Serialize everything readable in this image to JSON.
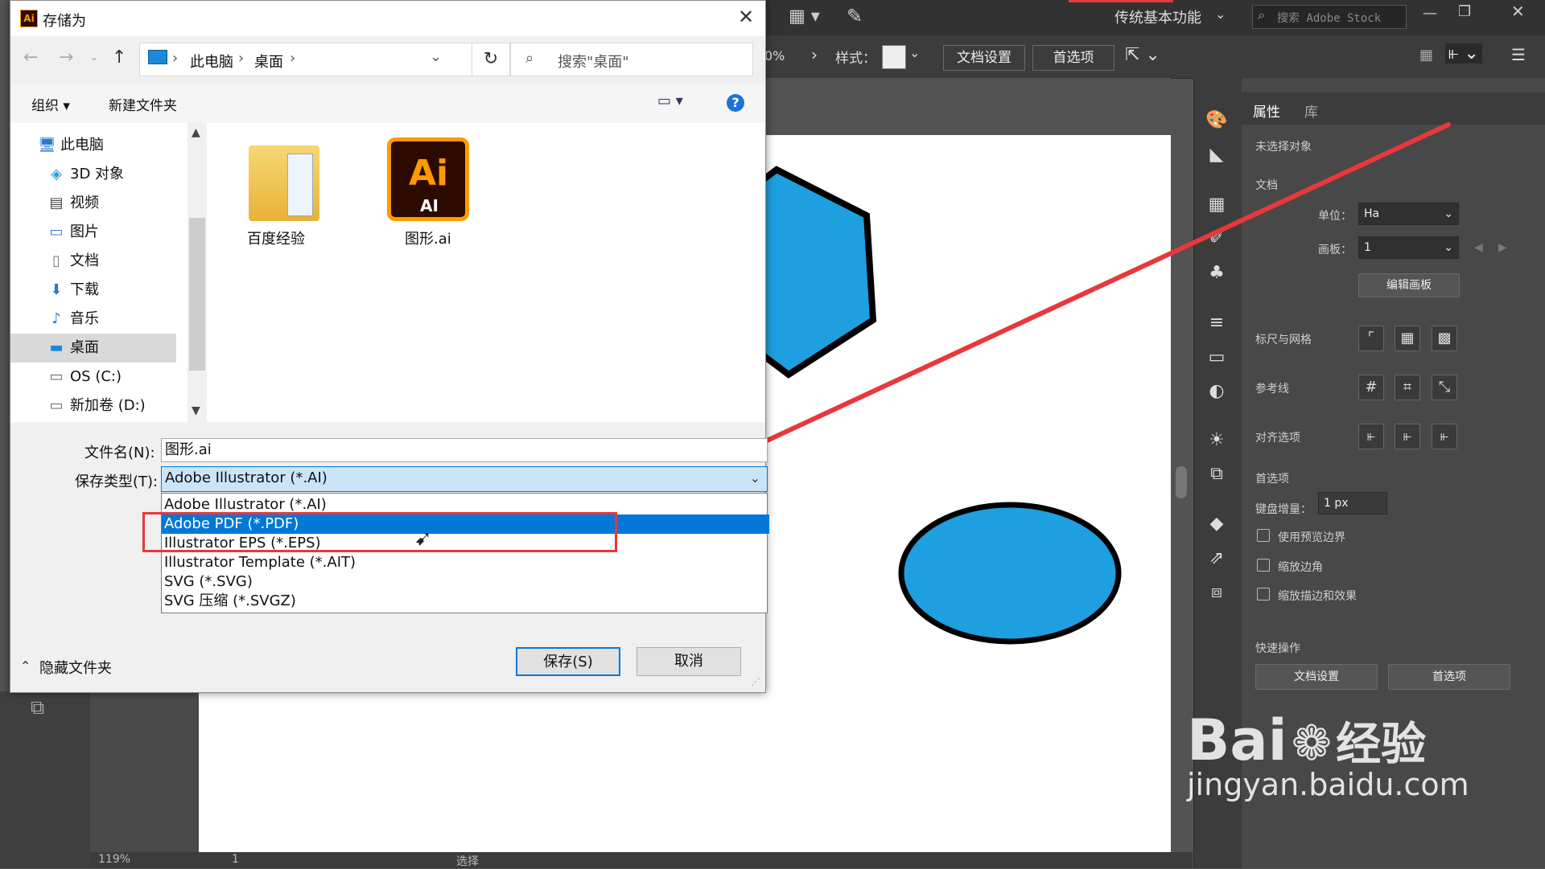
{
  "dialog": {
    "title": "存储为",
    "address": {
      "root": "此电脑",
      "folder": "桌面"
    },
    "search_placeholder": "搜索\"桌面\"",
    "toolbar": {
      "organize": "组织 ▾",
      "new_folder": "新建文件夹",
      "help": "?"
    },
    "nav_items": [
      "此电脑",
      "3D 对象",
      "视频",
      "图片",
      "文档",
      "下载",
      "音乐",
      "桌面",
      "OS (C:)",
      "新加卷 (D:)"
    ],
    "files": [
      {
        "name": "百度经验",
        "type": "folder"
      },
      {
        "name": "图形.ai",
        "type": "ai-file",
        "badge": "Ai",
        "badge_sub": "AI"
      }
    ],
    "filename_label": "文件名(N):",
    "filename_value": "图形.ai",
    "filetype_label": "保存类型(T):",
    "filetype_value": "Adobe Illustrator (*.AI)",
    "filetype_options": [
      "Adobe Illustrator (*.AI)",
      "Adobe PDF (*.PDF)",
      "Illustrator EPS (*.EPS)",
      "Illustrator Template (*.AIT)",
      "SVG (*.SVG)",
      "SVG 压缩 (*.SVGZ)"
    ],
    "selected_option": "Adobe PDF (*.PDF)",
    "hide_folders": "隐藏文件夹",
    "save_button": "保存(S)",
    "cancel_button": "取消"
  },
  "illustrator": {
    "workspace": "传统基本功能",
    "stock_search": "搜索 Adobe Stock",
    "zoom_partial": "0%",
    "style_label": "样式：",
    "doc_settings": "文档设置",
    "preferences": "首选项",
    "panel_tabs": [
      "属性",
      "库"
    ],
    "no_selection": "未选择对象",
    "document": "文档",
    "unit_label": "单位：",
    "unit_value": "Ha",
    "artboard_label": "画板：",
    "artboard_value": "1",
    "edit_artboard": "编辑画板",
    "rulers_grids": "标尺与网格",
    "guides": "参考线",
    "align_options": "对齐选项",
    "prefs_section": "首选项",
    "keyboard_increment_label": "键盘增量：",
    "keyboard_increment_value": "1 px",
    "checkboxes": [
      "使用预览边界",
      "缩放边角",
      "缩放描边和效果"
    ],
    "quick_actions": "快速操作",
    "quick_doc_settings": "文档设置",
    "quick_preferences": "首选项",
    "status_zoom": "119%",
    "status_page": "1",
    "status_tool": "选择"
  },
  "watermark": {
    "brand": "Bai",
    "brand_cn": "经验",
    "url": "jingyan.baidu.com"
  },
  "colors": {
    "shape_fill": "#1d9fe0",
    "annotation": "#e8383d",
    "selection": "#0078d7"
  }
}
